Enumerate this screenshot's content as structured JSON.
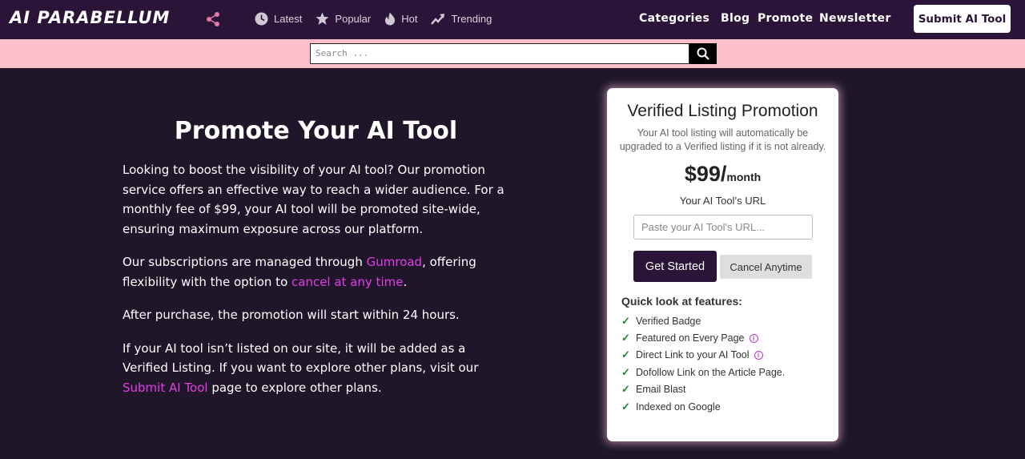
{
  "header": {
    "logo": "AI PARABELLUM",
    "nav_left": [
      {
        "label": "Latest",
        "icon": "clock-icon"
      },
      {
        "label": "Popular",
        "icon": "star-icon"
      },
      {
        "label": "Hot",
        "icon": "flame-icon"
      },
      {
        "label": "Trending",
        "icon": "trending-icon"
      }
    ],
    "nav_right": [
      "Categories",
      "Blog",
      "Promote",
      "Newsletter"
    ],
    "submit_label": "Submit AI Tool"
  },
  "search": {
    "placeholder": "Search ..."
  },
  "main": {
    "title": "Promote Your AI Tool",
    "p1": "Looking to boost the visibility of your AI tool? Our promotion service offers an effective way to reach a wider audience. For a monthly fee of $99, your AI tool will be promoted site-wide, ensuring maximum exposure across our platform.",
    "p2_before": "Our subscriptions are managed through ",
    "p2_link1": "Gumroad",
    "p2_mid": ", offering flexibility with the option to ",
    "p2_link2": "cancel at any time",
    "p2_after": ".",
    "p3": "After purchase, the promotion will start within 24 hours.",
    "p4_before": "If your AI tool isn’t listed on our site, it will be added as a Verified Listing. If you want to explore other plans, visit our ",
    "p4_link": "Submit AI Tool",
    "p4_after": " page to explore other plans."
  },
  "card": {
    "title": "Verified Listing Promotion",
    "desc": "Your AI tool listing will automatically be upgraded to a Verified listing if it is not already.",
    "price": "$99/",
    "period": "month",
    "url_label": "Your AI Tool’s URL",
    "url_placeholder": "Paste your AI Tool's URL...",
    "start_label": "Get Started",
    "cancel_label": "Cancel Anytime",
    "features_title": "Quick look at features:",
    "features": [
      "Verified Badge",
      "Featured on Every Page",
      "Direct Link to your AI Tool",
      "Dofollow Link on the Article Page.",
      "Email Blast",
      "Indexed on Google"
    ]
  },
  "colors": {
    "header_bg": "#2a1538",
    "search_bg": "#ffbfc8",
    "link": "#e43ce8",
    "body_bg": "#1f1729"
  }
}
